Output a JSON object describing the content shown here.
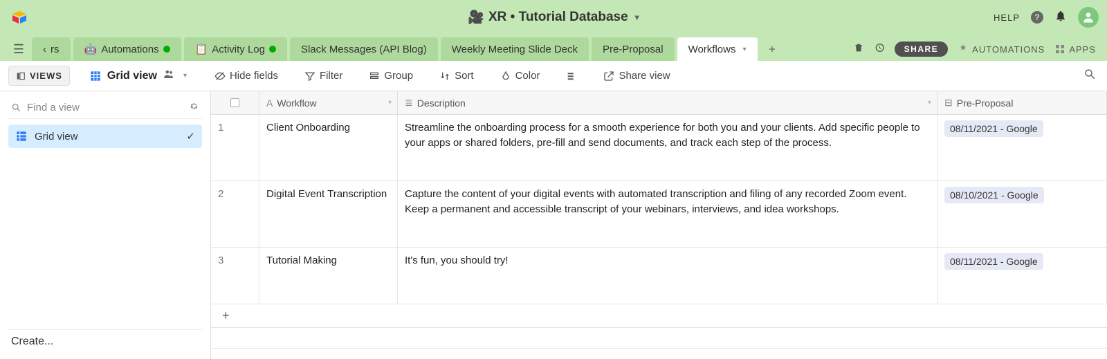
{
  "header": {
    "title_prefix": "XR",
    "title_sep": " • ",
    "title_suffix": "Tutorial Database",
    "help": "HELP"
  },
  "tabs": [
    {
      "label": "rs",
      "emoji": "⬅"
    },
    {
      "label": "Automations",
      "emoji": "🤖",
      "dot": true
    },
    {
      "label": "Activity Log",
      "emoji": "📋",
      "dot": true
    },
    {
      "label": "Slack Messages (API Blog)"
    },
    {
      "label": "Weekly Meeting Slide Deck"
    },
    {
      "label": "Pre-Proposal"
    },
    {
      "label": "Workflows",
      "active": true
    }
  ],
  "tabs_right": {
    "share": "SHARE",
    "automations": "AUTOMATIONS",
    "apps": "APPS"
  },
  "toolbar": {
    "views": "VIEWS",
    "view_name": "Grid view",
    "hide_fields": "Hide fields",
    "filter": "Filter",
    "group": "Group",
    "sort": "Sort",
    "color": "Color",
    "share_view": "Share view"
  },
  "sidebar": {
    "find_placeholder": "Find a view",
    "items": [
      {
        "label": "Grid view",
        "selected": true
      }
    ],
    "create": "Create..."
  },
  "columns": [
    {
      "name": "Workflow",
      "icon": "A"
    },
    {
      "name": "Description",
      "icon": "≣"
    },
    {
      "name": "Pre-Proposal",
      "icon": "⊟"
    }
  ],
  "rows": [
    {
      "num": "1",
      "workflow": "Client Onboarding",
      "description": "Streamline the onboarding process for a smooth experience for both you and your clients. Add specific people to your apps or shared folders, pre-fill and send documents, and track each step of the process.",
      "preproposal": "08/11/2021 - Google"
    },
    {
      "num": "2",
      "workflow": "Digital Event Transcription",
      "description": "Capture the content of your digital events with automated transcription and filing of any recorded Zoom event. Keep a permanent and accessible transcript of your webinars, interviews, and idea workshops.",
      "preproposal": "08/10/2021 - Google"
    },
    {
      "num": "3",
      "workflow": "Tutorial Making",
      "description": "It's fun, you should try!",
      "preproposal": "08/11/2021 - Google"
    }
  ]
}
